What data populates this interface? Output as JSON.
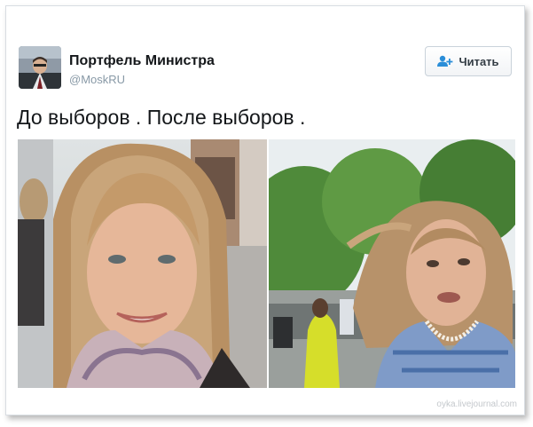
{
  "tweet": {
    "author": {
      "name": "Портфель Министра",
      "handle": "@MoskRU",
      "avatar": "avatar-photo"
    },
    "follow_button": {
      "label": "Читать",
      "icon": "add-user-icon",
      "icon_color": "#2b8ed8"
    },
    "text": "До выборов . После выборов .",
    "photos": [
      {
        "name": "left-photo",
        "description_icon": "photo"
      },
      {
        "name": "right-photo",
        "description_icon": "photo"
      }
    ]
  },
  "watermark": "oyka.livejournal.com",
  "colors": {
    "name_text": "#14171a",
    "handle_text": "#8899a6",
    "card_border": "#d8dde2"
  }
}
